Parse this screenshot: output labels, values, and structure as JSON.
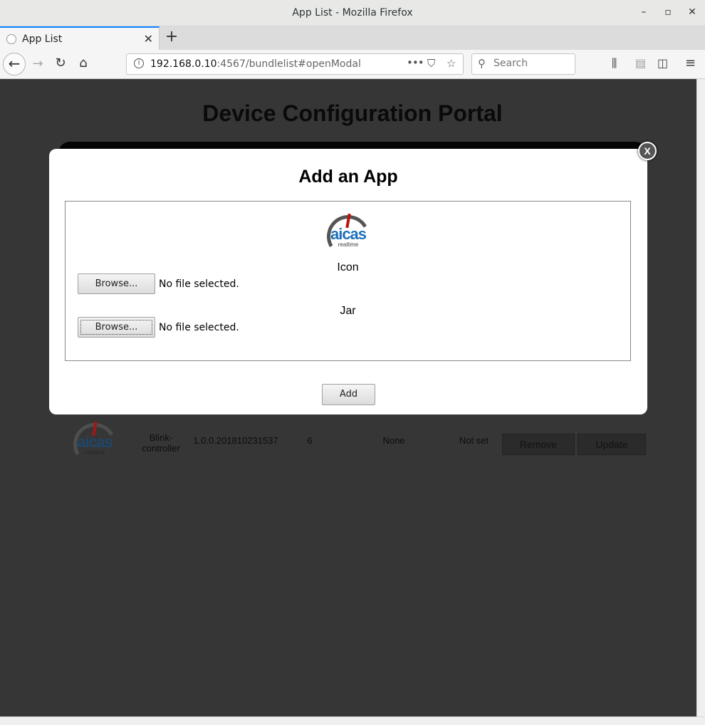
{
  "window": {
    "title": "App List - Mozilla Firefox",
    "controls": {
      "minimize": "–",
      "maximize": "▫",
      "close": "✕"
    }
  },
  "tab": {
    "label": "App List",
    "close": "✕",
    "new_tab": "+"
  },
  "navbar": {
    "url_host": "192.168.0.10",
    "url_rest": ":4567/bundlelist#openModal",
    "page_actions": "•••",
    "search_placeholder": "Search",
    "icons": [
      "back-icon",
      "forward-icon",
      "reload-icon",
      "home-icon",
      "pocket-icon",
      "bookmark-star-icon",
      "library-icon",
      "reader-icon",
      "sidebar-icon",
      "menu-icon"
    ]
  },
  "page": {
    "title": "Device Configuration Portal"
  },
  "app_row": {
    "logo_word": "aicas",
    "logo_sub": "realtime",
    "name": "Blink-\ncontroller",
    "version": "1.0.0.201810231537",
    "id": "6",
    "dependency": "None",
    "status": "Not set",
    "remove_label": "Remove",
    "update_label": "Update"
  },
  "modal": {
    "close_label": "X",
    "title": "Add an App",
    "logo_word": "aicas",
    "logo_sub": "realtime",
    "icon_label": "Icon",
    "jar_label": "Jar",
    "browse_label": "Browse...",
    "icon_file_status": "No file selected.",
    "jar_file_status": "No file selected.",
    "add_label": "Add"
  },
  "colors": {
    "page_bg": "#363636",
    "modal_bg": "#ffffff",
    "logo_blue": "#1d6fb8",
    "tab_accent": "#0a84ff"
  }
}
